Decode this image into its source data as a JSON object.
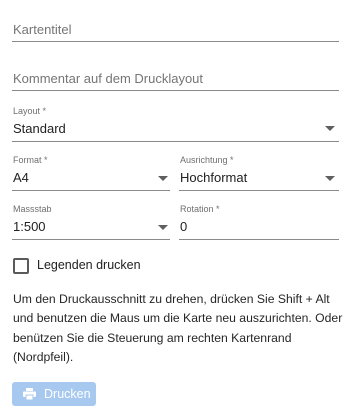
{
  "form": {
    "title_placeholder": "Kartentitel",
    "comment_placeholder": "Kommentar auf dem Drucklayout",
    "layout": {
      "label": "Layout *",
      "value": "Standard"
    },
    "format": {
      "label": "Format *",
      "value": "A4"
    },
    "orientation": {
      "label": "Ausrichtung *",
      "value": "Hochformat"
    },
    "scale": {
      "label": "Massstab",
      "value": "1:500"
    },
    "rotation": {
      "label": "Rotation *",
      "value": "0"
    },
    "legend_checkbox": {
      "label": "Legenden drucken",
      "checked": false
    }
  },
  "hint_text": "Um den Druckausschnitt zu drehen, drücken Sie Shift + Alt und benutzen die Maus um die Karte neu auszurichten. Oder benützen Sie die Steuerung am rechten Kartenrand (Nordpfeil).",
  "print_button": {
    "label": "Drucken",
    "icon": "printer-icon",
    "color": "#a7c9ef",
    "disabled": true
  }
}
